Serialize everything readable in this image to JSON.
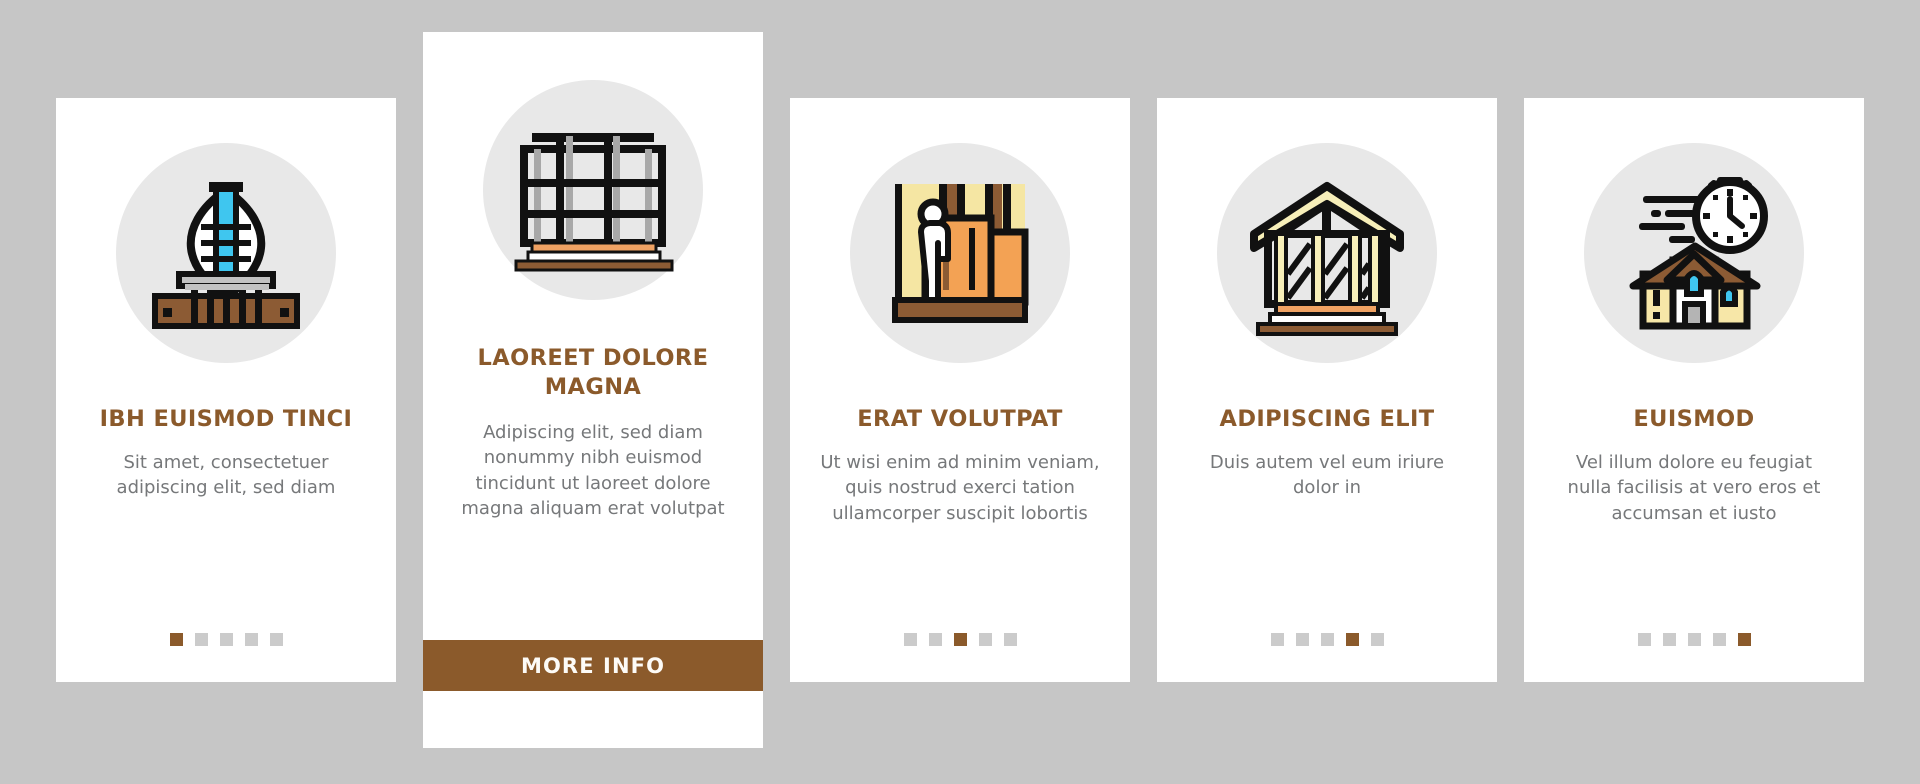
{
  "page": {
    "background_color": "#c6c6c6",
    "accent_color": "#8b5a2b",
    "body_text_color": "#76787a",
    "icon_circle_color": "#e8e8e8",
    "card_background": "#ffffff"
  },
  "cards": [
    {
      "icon_name": "ground-screw-foundation-icon",
      "title": "IBH EUISMOD TINCI",
      "body": "Sit amet, consectetuer adipiscing elit, sed diam",
      "featured": false,
      "dots": {
        "count": 5,
        "active_index": 0
      }
    },
    {
      "icon_name": "building-frame-scaffolding-icon",
      "title": "LAOREET DOLORE MAGNA",
      "body": "Adipiscing elit, sed diam nonummy nibh euismod tincidunt ut laoreet dolore magna aliquam erat volutpat",
      "featured": true,
      "cta_label": "MORE INFO",
      "dots": {
        "count": 0,
        "active_index": -1
      }
    },
    {
      "icon_name": "worker-installing-wall-panel-icon",
      "title": "ERAT VOLUTPAT",
      "body": "Ut wisi enim ad minim veniam, quis nostrud exerci tation ullamcorper suscipit lobortis",
      "featured": false,
      "dots": {
        "count": 5,
        "active_index": 2
      }
    },
    {
      "icon_name": "timber-frame-house-icon",
      "title": "ADIPISCING ELIT",
      "body": "Duis autem vel eum iriure dolor in",
      "featured": false,
      "dots": {
        "count": 5,
        "active_index": 3
      }
    },
    {
      "icon_name": "house-fast-build-clock-icon",
      "title": "EUISMOD",
      "body": "Vel illum dolore eu feugiat nulla facilisis at vero eros et accumsan et iusto",
      "featured": false,
      "dots": {
        "count": 5,
        "active_index": 4
      }
    }
  ]
}
